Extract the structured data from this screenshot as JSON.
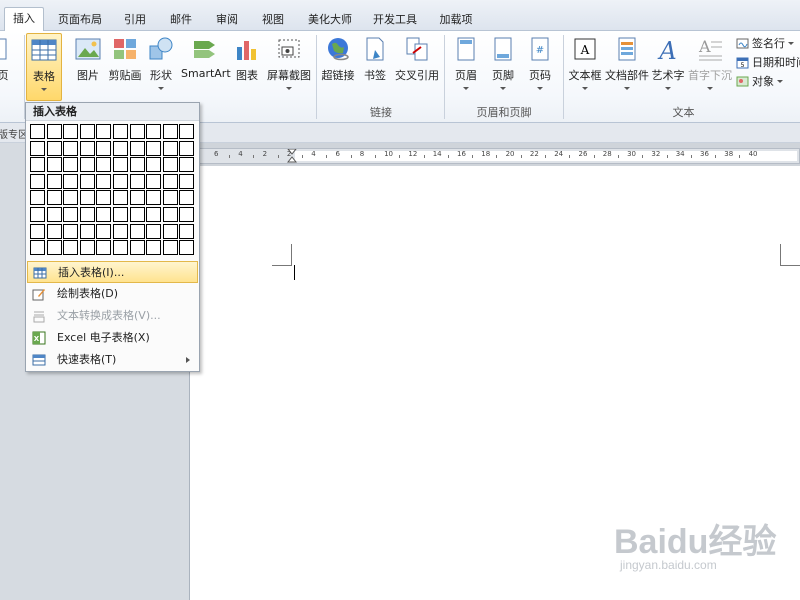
{
  "tabs": [
    {
      "label": "插入",
      "active": true
    },
    {
      "label": "页面布局"
    },
    {
      "label": "引用"
    },
    {
      "label": "邮件"
    },
    {
      "label": "审阅"
    },
    {
      "label": "视图"
    },
    {
      "label": "美化大师"
    },
    {
      "label": "开发工具"
    },
    {
      "label": "加载项"
    }
  ],
  "ribbon": {
    "partial_left_label": "页",
    "tables_group": {
      "table_label": "表格"
    },
    "illustrations_group": {
      "picture_label": "图片",
      "clipart_label": "剪贴画",
      "shapes_label": "形状",
      "smartart_label": "SmartArt",
      "chart_label": "图表",
      "screenshot_label": "屏幕截图"
    },
    "links_group": {
      "hyperlink_label": "超链接",
      "bookmark_label": "书签",
      "crossref_label": "交叉引用",
      "group_label": "链接"
    },
    "header_footer_group": {
      "header_label": "页眉",
      "footer_label": "页脚",
      "page_number_label": "页码",
      "group_label": "页眉和页脚"
    },
    "text_group": {
      "textbox_label": "文本框",
      "quickparts_label": "文档部件",
      "wordart_label": "艺术字",
      "dropcap_label": "首字下沉",
      "signature_label": "签名行",
      "datetime_label": "日期和时间",
      "object_label": "对象",
      "group_label": "文本"
    }
  },
  "toolbar": {
    "partial_label": "版专区"
  },
  "ruler": {
    "numbers": [
      "6",
      "4",
      "2",
      "2",
      "4",
      "6",
      "8",
      "10",
      "12",
      "14",
      "16",
      "18",
      "20",
      "22",
      "24",
      "26",
      "28",
      "30",
      "32",
      "34",
      "36",
      "38",
      "40"
    ]
  },
  "dropdown": {
    "title": "插入表格",
    "grid": {
      "cols": 10,
      "rows": 8
    },
    "items": [
      {
        "label": "插入表格(I)...",
        "highlighted": true
      },
      {
        "label": "绘制表格(D)"
      },
      {
        "label": "文本转换成表格(V)...",
        "disabled": true
      },
      {
        "label": "Excel 电子表格(X)"
      },
      {
        "label": "快速表格(T)",
        "submenu": true
      }
    ]
  },
  "watermark": {
    "brand": "Baidu经验",
    "url": "jingyan.baidu.com"
  },
  "colors": {
    "accent": "#ffd86b",
    "ribbon_bg": "#f5f8fc",
    "canvas_gray": "#d6dbe1"
  }
}
